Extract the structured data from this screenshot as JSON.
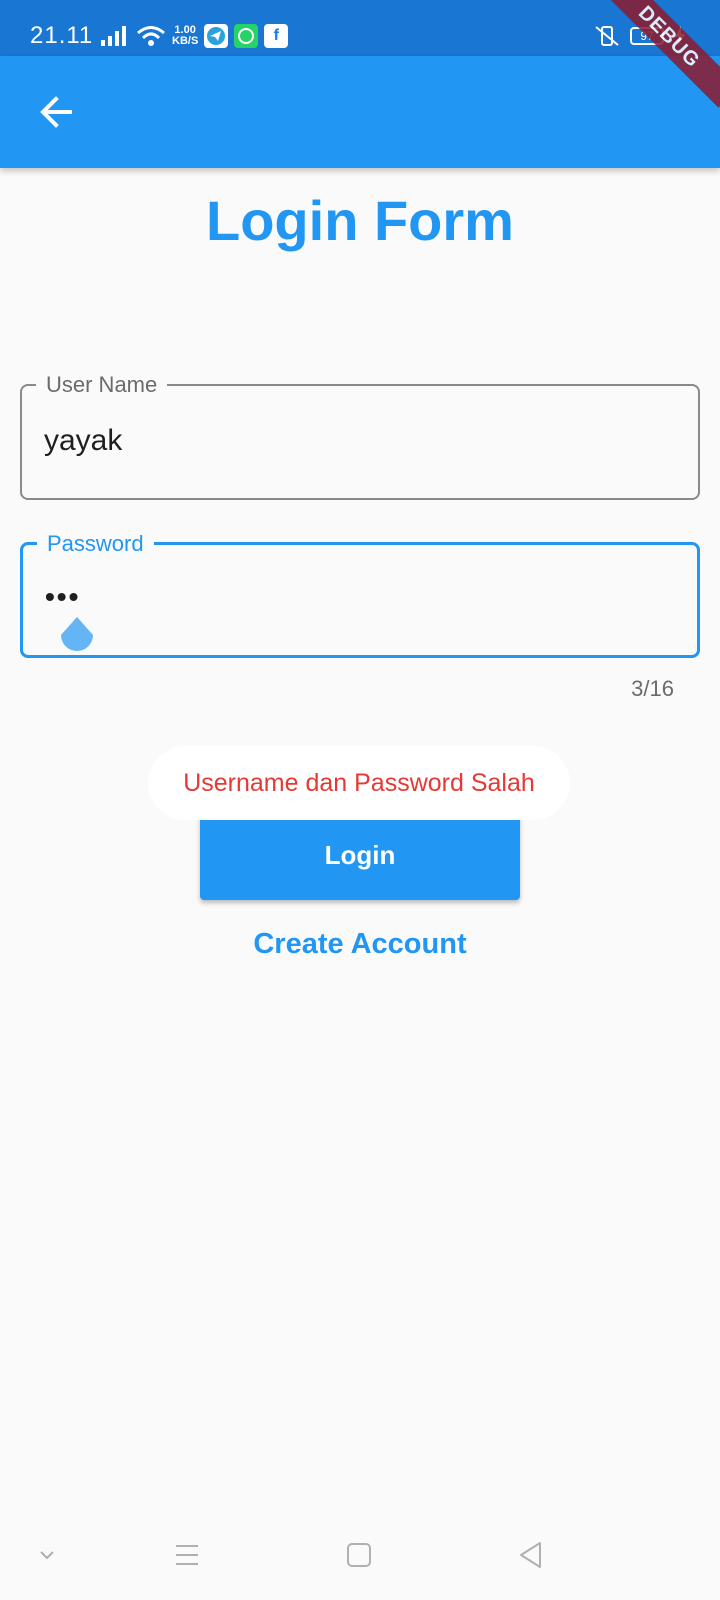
{
  "status_bar": {
    "time": "21.11",
    "net_speed_value": "1.00",
    "net_speed_unit": "KB/S",
    "battery": "97",
    "icons": [
      "signal-icon",
      "wifi-icon",
      "telegram-icon",
      "whatsapp-icon",
      "facebook-icon",
      "vibrate-icon",
      "battery-icon",
      "charging-icon"
    ]
  },
  "app_bar": {
    "back_icon": "arrow-back-icon"
  },
  "debug_banner": {
    "label": "DEBUG"
  },
  "form": {
    "title": "Login Form",
    "username": {
      "label": "User Name",
      "value": "yayak"
    },
    "password": {
      "label": "Password",
      "masked_value": "•••",
      "counter": "3/16"
    },
    "login_label": "Login",
    "create_account_label": "Create Account"
  },
  "toast": {
    "message": "Username dan Password Salah"
  },
  "nav_bar": {
    "icons": [
      "chevron-down-icon",
      "menu-icon",
      "home-icon",
      "back-triangle-icon"
    ]
  },
  "colors": {
    "primary": "#2196f3",
    "status_bar": "#1976d2",
    "error_text": "#e53935",
    "background": "#fafafa"
  }
}
